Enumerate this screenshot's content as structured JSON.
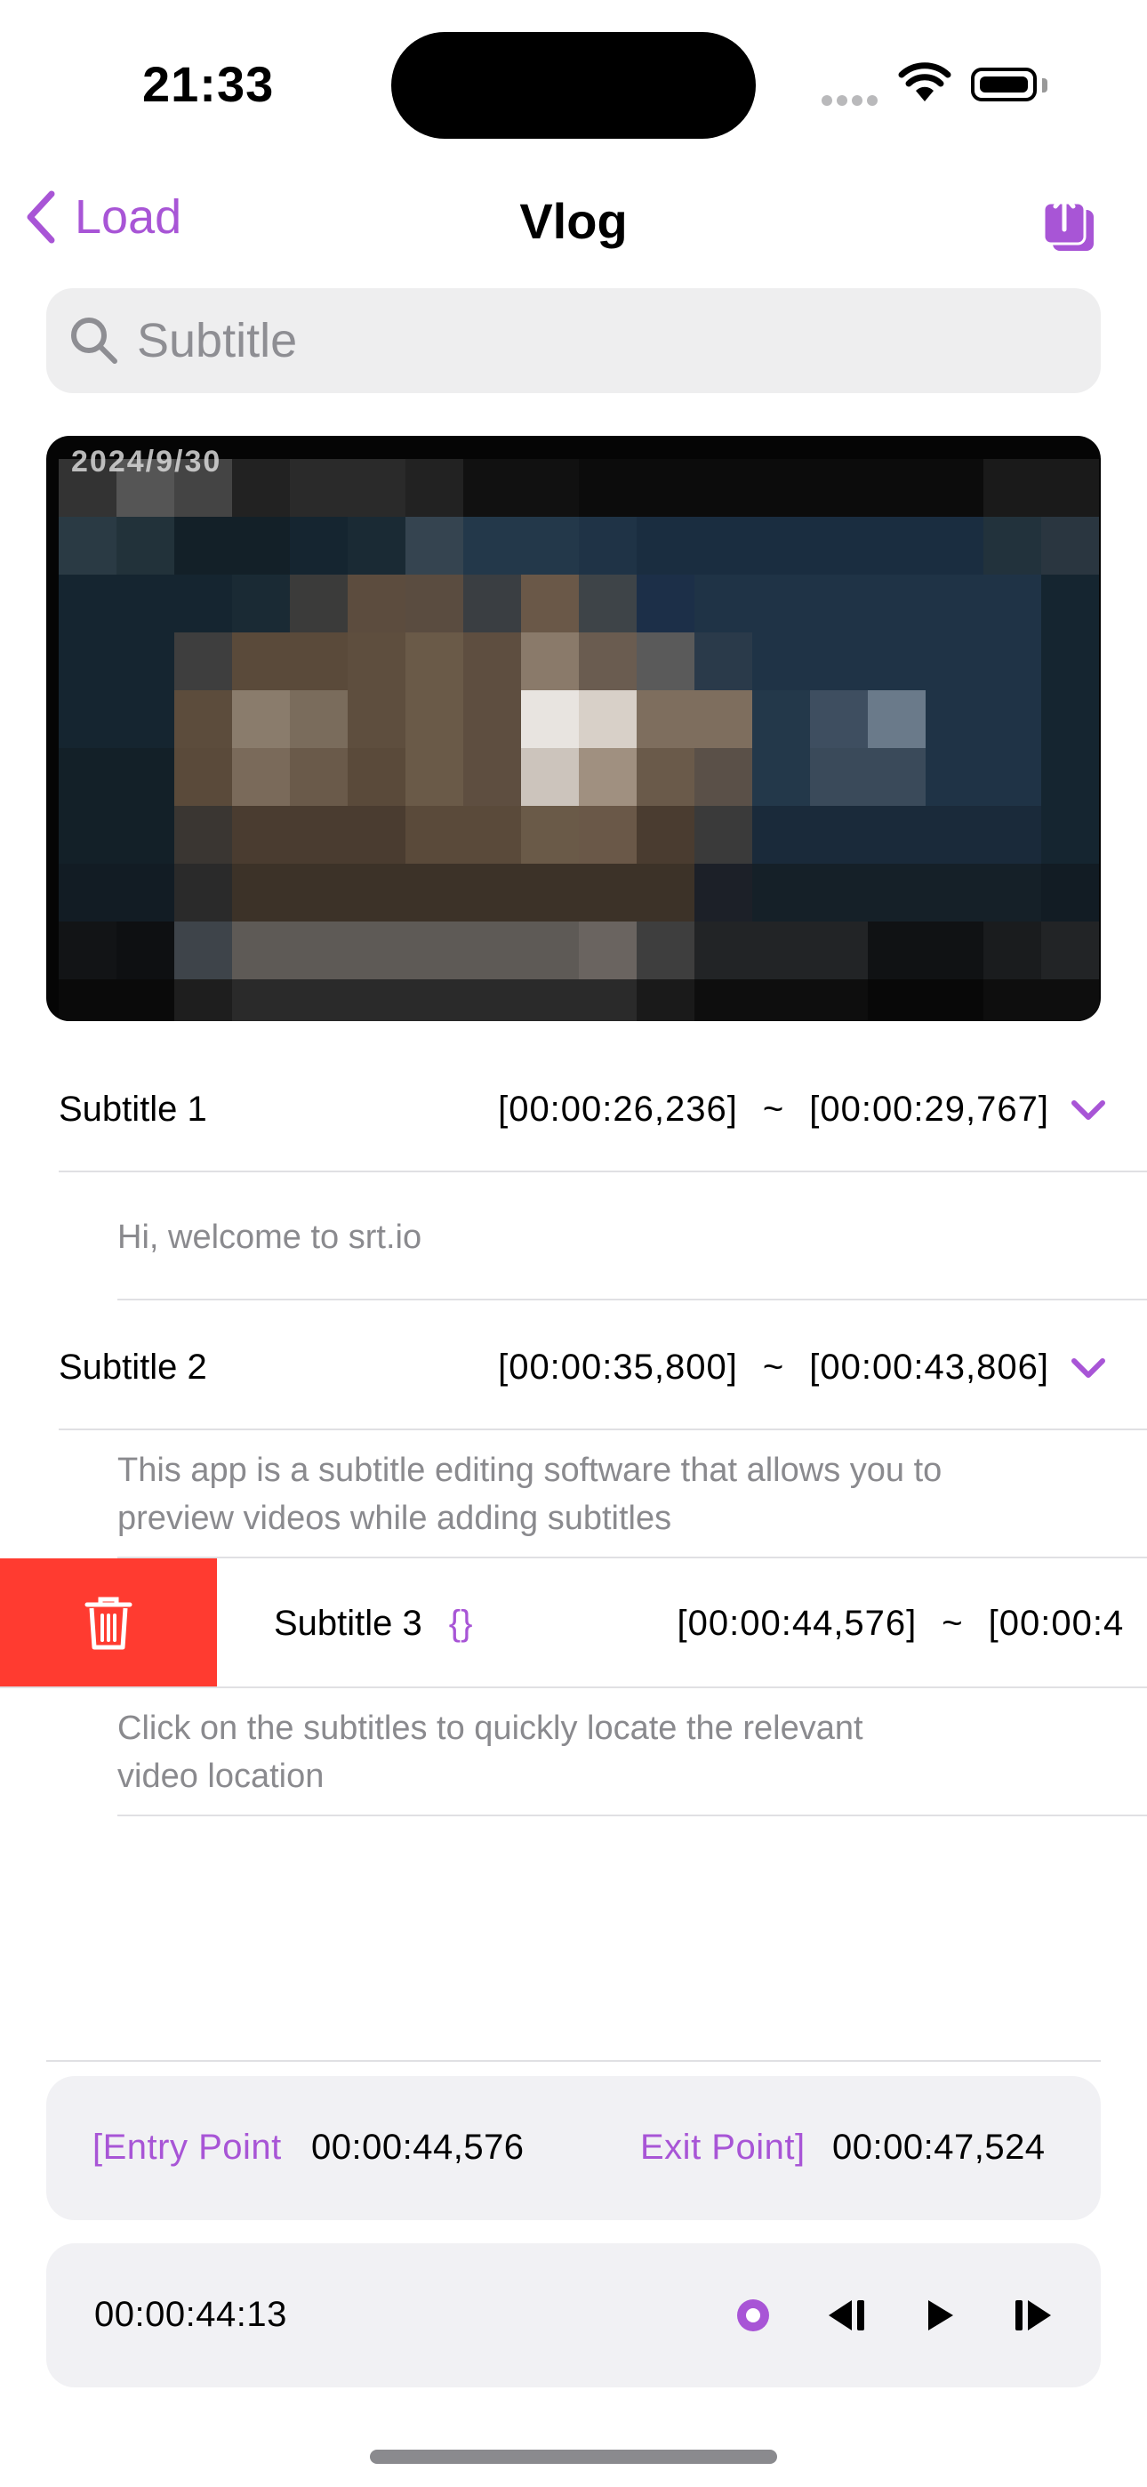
{
  "status_bar": {
    "time": "21:33"
  },
  "nav": {
    "back_label": "Load",
    "title": "Vlog"
  },
  "search": {
    "placeholder": "Subtitle"
  },
  "video": {
    "overlay_text": "2024/9/30"
  },
  "subtitles": [
    {
      "label": "Subtitle 1",
      "start": "[00:00:26,236]",
      "sep": "~",
      "end": "[00:00:29,767]",
      "text": "Hi, welcome to srt.io"
    },
    {
      "label": "Subtitle 2",
      "start": "[00:00:35,800]",
      "sep": "~",
      "end": "[00:00:43,806]",
      "text_line1": "This app is a subtitle editing software that allows you to",
      "text_line2": "preview videos while adding subtitles"
    },
    {
      "label": "Subtitle 3",
      "badge": "{}",
      "start": "[00:00:44,576]",
      "sep": "~",
      "end": "[00:00:4",
      "text_line1": "Click on the subtitles to quickly locate the relevant",
      "text_line2": "video location"
    }
  ],
  "points": {
    "entry_label": "[Entry Point",
    "entry_value": "00:00:44,576",
    "exit_label": "Exit Point]",
    "exit_value": "00:00:47,524"
  },
  "player": {
    "current_time": "00:00:44:13"
  },
  "icons": [
    "chevron-left-icon",
    "share-icon",
    "search-icon",
    "chevron-down-icon",
    "trash-icon",
    "record-icon",
    "step-back-icon",
    "play-icon",
    "step-forward-icon"
  ],
  "colors": {
    "accent": "#a855d6",
    "delete": "#ff3b30",
    "panel": "#f1f1f4"
  }
}
